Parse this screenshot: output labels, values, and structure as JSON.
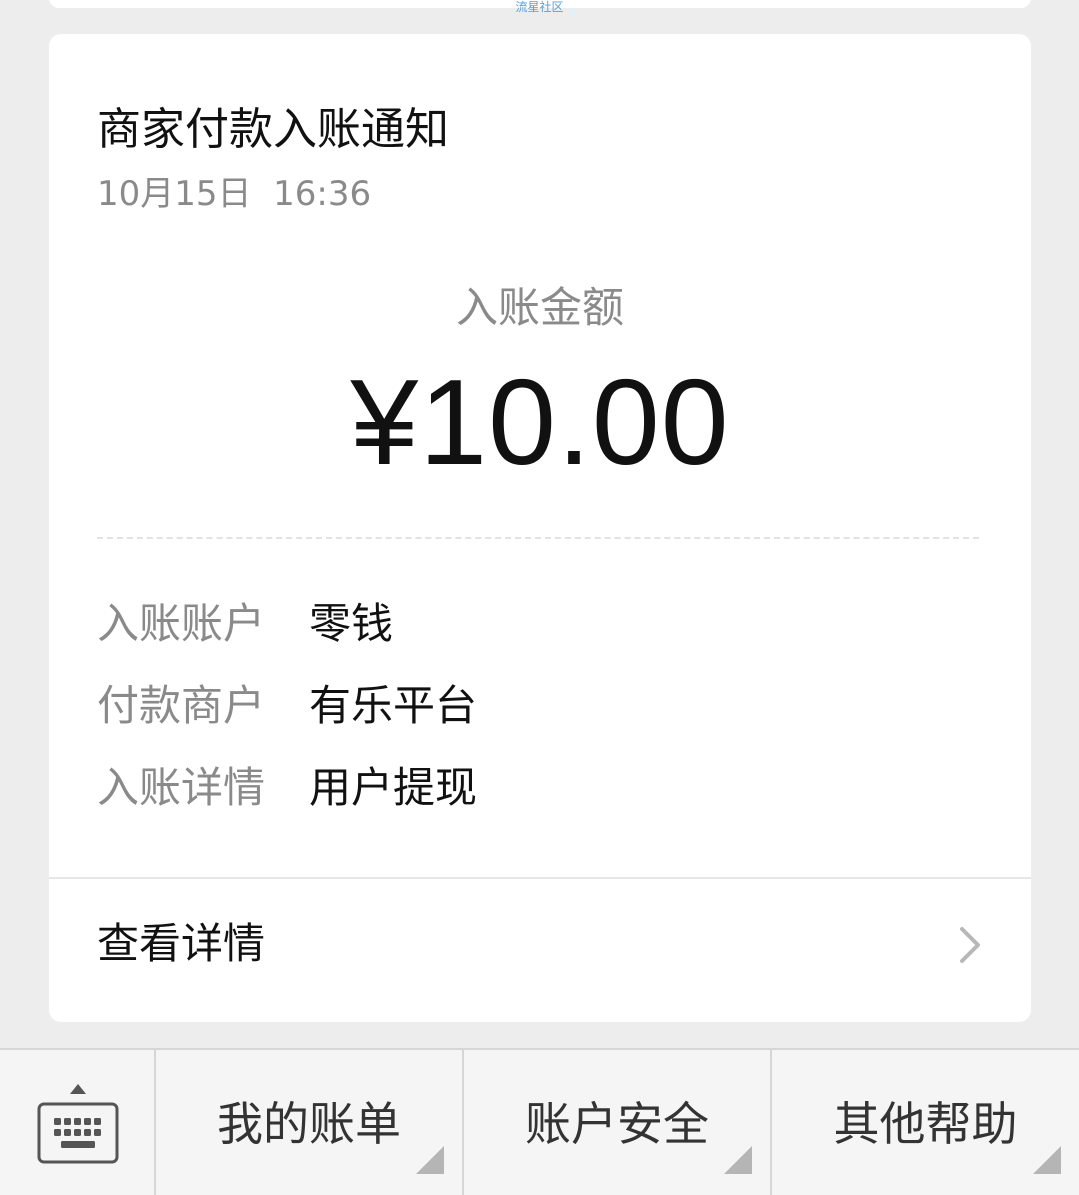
{
  "watermark": "流星社区",
  "notification": {
    "title": "商家付款入账通知",
    "datetime": "10月15日  16:36",
    "amount_label": "入账金额",
    "amount": "¥10.00",
    "details": [
      {
        "key": "入账账户",
        "value": "零钱"
      },
      {
        "key": "付款商户",
        "value": "有乐平台"
      },
      {
        "key": "入账详情",
        "value": "用户提现"
      }
    ],
    "view_details": "查看详情"
  },
  "menu": {
    "keyboard_icon": "keyboard-icon",
    "items": [
      {
        "label": "我的账单"
      },
      {
        "label": "账户安全"
      },
      {
        "label": "其他帮助"
      }
    ]
  },
  "colors": {
    "background": "#ededed",
    "card": "#ffffff",
    "primary_text": "#111111",
    "secondary_text": "#8a8a8a",
    "bar_background": "#f5f5f5"
  }
}
